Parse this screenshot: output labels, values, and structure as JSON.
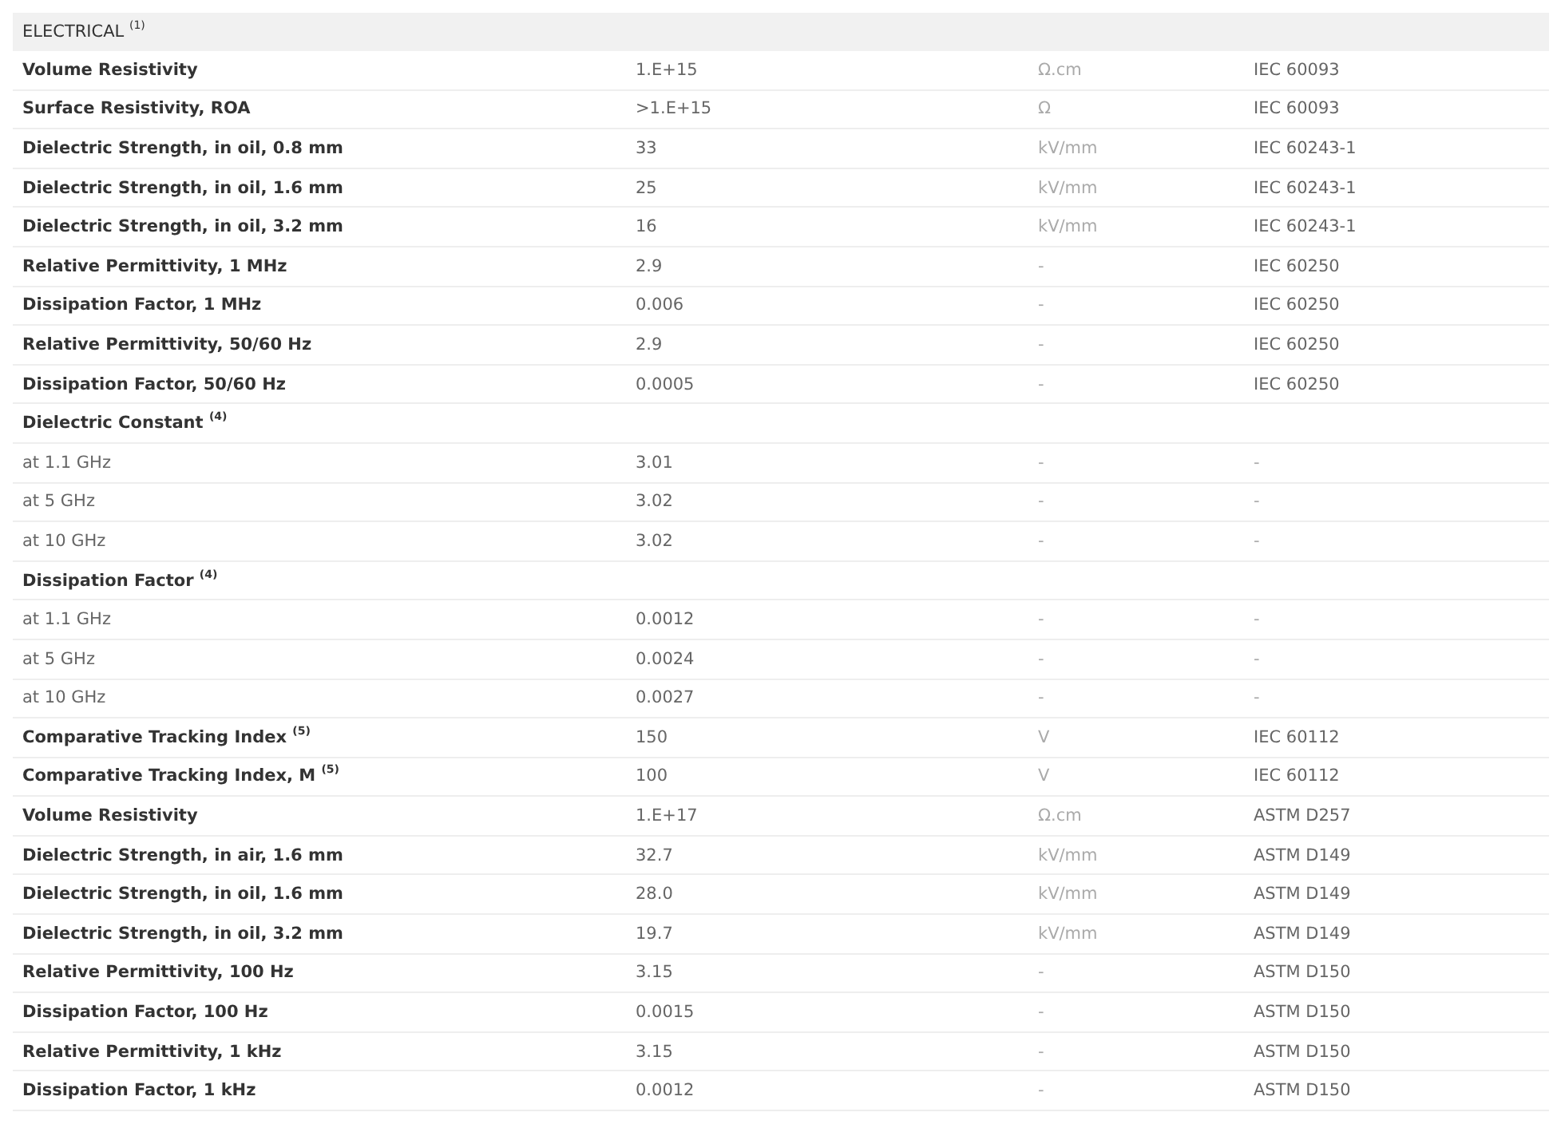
{
  "section": {
    "title": "ELECTRICAL $^{(1)}$"
  },
  "rows": [
    {
      "kind": "property",
      "property": "Volume Resistivity",
      "value": "1.E+15",
      "unit": "Ω.cm",
      "standard": "IEC 60093"
    },
    {
      "kind": "property",
      "property": "Surface Resistivity, ROA",
      "value": ">1.E+15",
      "unit": "Ω",
      "standard": "IEC 60093"
    },
    {
      "kind": "property",
      "property": "Dielectric Strength, in oil, 0.8 mm",
      "value": "33",
      "unit": "kV/mm",
      "standard": "IEC 60243-1"
    },
    {
      "kind": "property",
      "property": "Dielectric Strength, in oil, 1.6 mm",
      "value": "25",
      "unit": "kV/mm",
      "standard": "IEC 60243-1"
    },
    {
      "kind": "property",
      "property": "Dielectric Strength, in oil, 3.2 mm",
      "value": "16",
      "unit": "kV/mm",
      "standard": "IEC 60243-1"
    },
    {
      "kind": "property",
      "property": "Relative Permittivity, 1 MHz",
      "value": "2.9",
      "unit": "-",
      "standard": "IEC 60250"
    },
    {
      "kind": "property",
      "property": "Dissipation Factor, 1 MHz",
      "value": "0.006",
      "unit": "-",
      "standard": "IEC 60250"
    },
    {
      "kind": "property",
      "property": "Relative Permittivity, 50/60 Hz",
      "value": "2.9",
      "unit": "-",
      "standard": "IEC 60250"
    },
    {
      "kind": "property",
      "property": "Dissipation Factor, 50/60 Hz",
      "value": "0.0005",
      "unit": "-",
      "standard": "IEC 60250"
    },
    {
      "kind": "group",
      "property": "Dielectric Constant $^{(4)}$"
    },
    {
      "kind": "sub",
      "property": "at 1.1 GHz",
      "value": "3.01",
      "unit": "-",
      "standard": "-"
    },
    {
      "kind": "sub",
      "property": "at 5 GHz",
      "value": "3.02",
      "unit": "-",
      "standard": "-"
    },
    {
      "kind": "sub",
      "property": "at 10 GHz",
      "value": "3.02",
      "unit": "-",
      "standard": "-"
    },
    {
      "kind": "group",
      "property": "Dissipation Factor $^{(4)}$"
    },
    {
      "kind": "sub",
      "property": "at 1.1 GHz",
      "value": "0.0012",
      "unit": "-",
      "standard": "-"
    },
    {
      "kind": "sub",
      "property": "at 5 GHz",
      "value": "0.0024",
      "unit": "-",
      "standard": "-"
    },
    {
      "kind": "sub",
      "property": "at 10 GHz",
      "value": "0.0027",
      "unit": "-",
      "standard": "-"
    },
    {
      "kind": "property",
      "property": "Comparative Tracking Index $^{(5)}$",
      "value": "150",
      "unit": "V",
      "standard": "IEC 60112"
    },
    {
      "kind": "property",
      "property": "Comparative Tracking Index, M $^{(5)}$",
      "value": "100",
      "unit": "V",
      "standard": "IEC 60112"
    },
    {
      "kind": "property",
      "property": "Volume Resistivity",
      "value": "1.E+17",
      "unit": "Ω.cm",
      "standard": "ASTM D257"
    },
    {
      "kind": "property",
      "property": "Dielectric Strength, in air, 1.6 mm",
      "value": "32.7",
      "unit": "kV/mm",
      "standard": "ASTM D149"
    },
    {
      "kind": "property",
      "property": "Dielectric Strength, in oil, 1.6 mm",
      "value": "28.0",
      "unit": "kV/mm",
      "standard": "ASTM D149"
    },
    {
      "kind": "property",
      "property": "Dielectric Strength, in oil, 3.2 mm",
      "value": "19.7",
      "unit": "kV/mm",
      "standard": "ASTM D149"
    },
    {
      "kind": "property",
      "property": "Relative Permittivity, 100 Hz",
      "value": "3.15",
      "unit": "-",
      "standard": "ASTM D150"
    },
    {
      "kind": "property",
      "property": "Dissipation Factor, 100 Hz",
      "value": "0.0015",
      "unit": "-",
      "standard": "ASTM D150"
    },
    {
      "kind": "property",
      "property": "Relative Permittivity, 1 kHz",
      "value": "3.15",
      "unit": "-",
      "standard": "ASTM D150"
    },
    {
      "kind": "property",
      "property": "Dissipation Factor, 1 kHz",
      "value": "0.0012",
      "unit": "-",
      "standard": "ASTM D150"
    }
  ]
}
